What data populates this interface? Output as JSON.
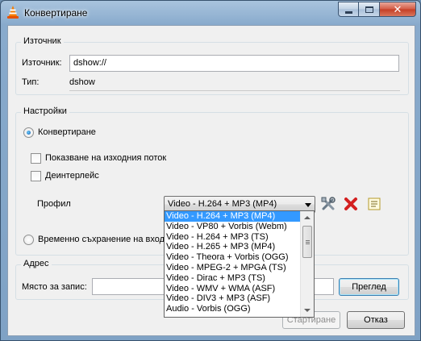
{
  "window": {
    "title": "Конвертиране"
  },
  "source": {
    "group_title": "Източник",
    "source_label": "Източник:",
    "source_value": "dshow://",
    "type_label": "Тип:",
    "type_value": "dshow"
  },
  "settings": {
    "group_title": "Настройки",
    "convert_label": "Конвертиране",
    "show_output_label": "Показване на изходния поток",
    "deinterlace_label": "Деинтерлейс",
    "profile_label": "Профил",
    "profile_selected": "Video - H.264 + MP3 (MP4)",
    "dump_label": "Временно съхранение на входа"
  },
  "profile_options": [
    "Video - H.264 + MP3 (MP4)",
    "Video - VP80 + Vorbis (Webm)",
    "Video - H.264 + MP3 (TS)",
    "Video - H.265 + MP3 (MP4)",
    "Video - Theora + Vorbis (OGG)",
    "Video - MPEG-2 + MPGA (TS)",
    "Video - Dirac + MP3 (TS)",
    "Video - WMV + WMA (ASF)",
    "Video - DIV3 + MP3 (ASF)",
    "Audio - Vorbis (OGG)"
  ],
  "destination": {
    "group_title": "Адрес",
    "file_label": "Място за запис:",
    "browse_label": "Преглед"
  },
  "buttons": {
    "start_label": "Стартиране",
    "cancel_label": "Отказ"
  },
  "colors": {
    "selection": "#3399ff",
    "delete_icon": "#d42020"
  }
}
